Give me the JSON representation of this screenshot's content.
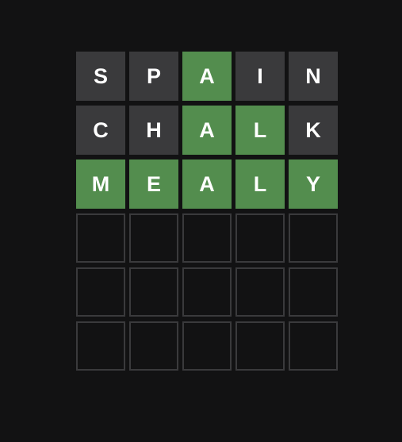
{
  "game": "wordle",
  "colors": {
    "background": "#121213",
    "absent": "#3a3a3c",
    "correct": "#538d4e",
    "empty_border": "#3a3a3c",
    "text": "#ffffff"
  },
  "board": {
    "rows": [
      {
        "letters": [
          "S",
          "P",
          "A",
          "I",
          "N"
        ],
        "states": [
          "absent",
          "absent",
          "correct",
          "absent",
          "absent"
        ]
      },
      {
        "letters": [
          "C",
          "H",
          "A",
          "L",
          "K"
        ],
        "states": [
          "absent",
          "absent",
          "correct",
          "correct",
          "absent"
        ]
      },
      {
        "letters": [
          "M",
          "E",
          "A",
          "L",
          "Y"
        ],
        "states": [
          "correct",
          "correct",
          "correct",
          "correct",
          "correct"
        ]
      },
      {
        "letters": [
          "",
          "",
          "",
          "",
          ""
        ],
        "states": [
          "empty",
          "empty",
          "empty",
          "empty",
          "empty"
        ]
      },
      {
        "letters": [
          "",
          "",
          "",
          "",
          ""
        ],
        "states": [
          "empty",
          "empty",
          "empty",
          "empty",
          "empty"
        ]
      },
      {
        "letters": [
          "",
          "",
          "",
          "",
          ""
        ],
        "states": [
          "empty",
          "empty",
          "empty",
          "empty",
          "empty"
        ]
      }
    ]
  }
}
